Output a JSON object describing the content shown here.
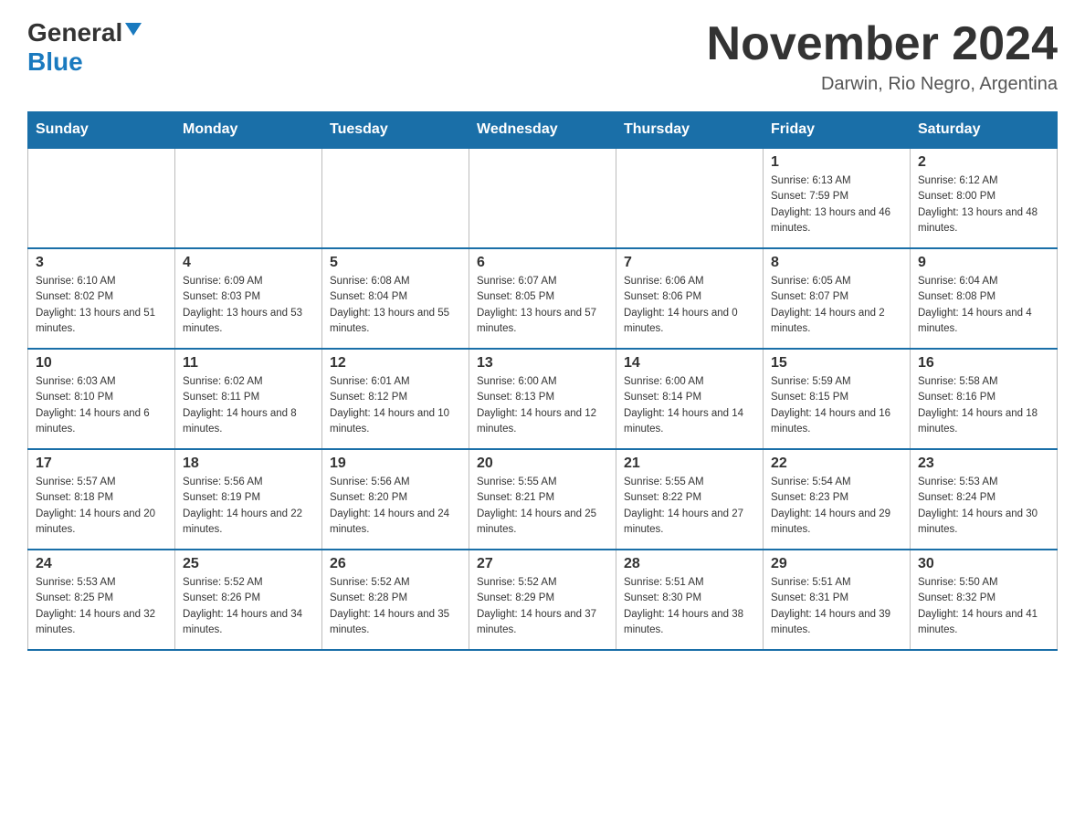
{
  "header": {
    "logo_general": "General",
    "logo_blue": "Blue",
    "month_title": "November 2024",
    "location": "Darwin, Rio Negro, Argentina"
  },
  "days_of_week": [
    "Sunday",
    "Monday",
    "Tuesday",
    "Wednesday",
    "Thursday",
    "Friday",
    "Saturday"
  ],
  "weeks": [
    [
      {
        "day": "",
        "info": ""
      },
      {
        "day": "",
        "info": ""
      },
      {
        "day": "",
        "info": ""
      },
      {
        "day": "",
        "info": ""
      },
      {
        "day": "",
        "info": ""
      },
      {
        "day": "1",
        "info": "Sunrise: 6:13 AM\nSunset: 7:59 PM\nDaylight: 13 hours and 46 minutes."
      },
      {
        "day": "2",
        "info": "Sunrise: 6:12 AM\nSunset: 8:00 PM\nDaylight: 13 hours and 48 minutes."
      }
    ],
    [
      {
        "day": "3",
        "info": "Sunrise: 6:10 AM\nSunset: 8:02 PM\nDaylight: 13 hours and 51 minutes."
      },
      {
        "day": "4",
        "info": "Sunrise: 6:09 AM\nSunset: 8:03 PM\nDaylight: 13 hours and 53 minutes."
      },
      {
        "day": "5",
        "info": "Sunrise: 6:08 AM\nSunset: 8:04 PM\nDaylight: 13 hours and 55 minutes."
      },
      {
        "day": "6",
        "info": "Sunrise: 6:07 AM\nSunset: 8:05 PM\nDaylight: 13 hours and 57 minutes."
      },
      {
        "day": "7",
        "info": "Sunrise: 6:06 AM\nSunset: 8:06 PM\nDaylight: 14 hours and 0 minutes."
      },
      {
        "day": "8",
        "info": "Sunrise: 6:05 AM\nSunset: 8:07 PM\nDaylight: 14 hours and 2 minutes."
      },
      {
        "day": "9",
        "info": "Sunrise: 6:04 AM\nSunset: 8:08 PM\nDaylight: 14 hours and 4 minutes."
      }
    ],
    [
      {
        "day": "10",
        "info": "Sunrise: 6:03 AM\nSunset: 8:10 PM\nDaylight: 14 hours and 6 minutes."
      },
      {
        "day": "11",
        "info": "Sunrise: 6:02 AM\nSunset: 8:11 PM\nDaylight: 14 hours and 8 minutes."
      },
      {
        "day": "12",
        "info": "Sunrise: 6:01 AM\nSunset: 8:12 PM\nDaylight: 14 hours and 10 minutes."
      },
      {
        "day": "13",
        "info": "Sunrise: 6:00 AM\nSunset: 8:13 PM\nDaylight: 14 hours and 12 minutes."
      },
      {
        "day": "14",
        "info": "Sunrise: 6:00 AM\nSunset: 8:14 PM\nDaylight: 14 hours and 14 minutes."
      },
      {
        "day": "15",
        "info": "Sunrise: 5:59 AM\nSunset: 8:15 PM\nDaylight: 14 hours and 16 minutes."
      },
      {
        "day": "16",
        "info": "Sunrise: 5:58 AM\nSunset: 8:16 PM\nDaylight: 14 hours and 18 minutes."
      }
    ],
    [
      {
        "day": "17",
        "info": "Sunrise: 5:57 AM\nSunset: 8:18 PM\nDaylight: 14 hours and 20 minutes."
      },
      {
        "day": "18",
        "info": "Sunrise: 5:56 AM\nSunset: 8:19 PM\nDaylight: 14 hours and 22 minutes."
      },
      {
        "day": "19",
        "info": "Sunrise: 5:56 AM\nSunset: 8:20 PM\nDaylight: 14 hours and 24 minutes."
      },
      {
        "day": "20",
        "info": "Sunrise: 5:55 AM\nSunset: 8:21 PM\nDaylight: 14 hours and 25 minutes."
      },
      {
        "day": "21",
        "info": "Sunrise: 5:55 AM\nSunset: 8:22 PM\nDaylight: 14 hours and 27 minutes."
      },
      {
        "day": "22",
        "info": "Sunrise: 5:54 AM\nSunset: 8:23 PM\nDaylight: 14 hours and 29 minutes."
      },
      {
        "day": "23",
        "info": "Sunrise: 5:53 AM\nSunset: 8:24 PM\nDaylight: 14 hours and 30 minutes."
      }
    ],
    [
      {
        "day": "24",
        "info": "Sunrise: 5:53 AM\nSunset: 8:25 PM\nDaylight: 14 hours and 32 minutes."
      },
      {
        "day": "25",
        "info": "Sunrise: 5:52 AM\nSunset: 8:26 PM\nDaylight: 14 hours and 34 minutes."
      },
      {
        "day": "26",
        "info": "Sunrise: 5:52 AM\nSunset: 8:28 PM\nDaylight: 14 hours and 35 minutes."
      },
      {
        "day": "27",
        "info": "Sunrise: 5:52 AM\nSunset: 8:29 PM\nDaylight: 14 hours and 37 minutes."
      },
      {
        "day": "28",
        "info": "Sunrise: 5:51 AM\nSunset: 8:30 PM\nDaylight: 14 hours and 38 minutes."
      },
      {
        "day": "29",
        "info": "Sunrise: 5:51 AM\nSunset: 8:31 PM\nDaylight: 14 hours and 39 minutes."
      },
      {
        "day": "30",
        "info": "Sunrise: 5:50 AM\nSunset: 8:32 PM\nDaylight: 14 hours and 41 minutes."
      }
    ]
  ]
}
